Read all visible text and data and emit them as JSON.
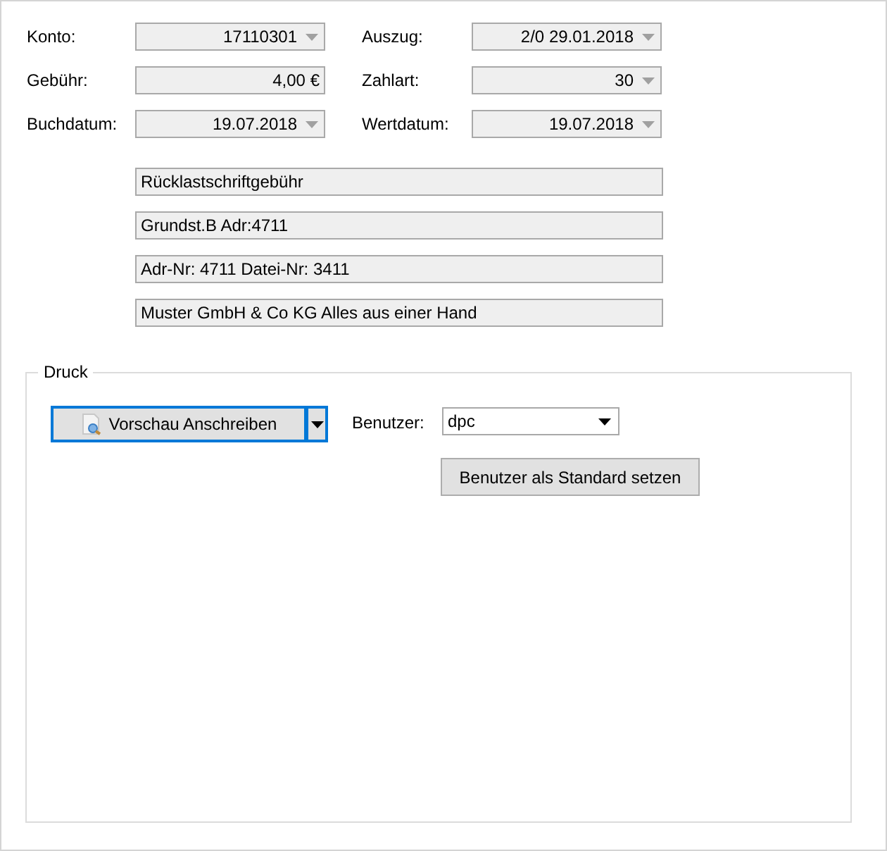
{
  "fields": [
    {
      "label": "Konto:",
      "value": "17110301",
      "kind": "combo"
    },
    {
      "label": "Auszug:",
      "value": "2/0 29.01.2018",
      "kind": "combo"
    },
    {
      "label": "Gebühr:",
      "value": "4,00 €",
      "kind": "text"
    },
    {
      "label": "Zahlart:",
      "value": "30",
      "kind": "combo"
    },
    {
      "label": "Buchdatum:",
      "value": "19.07.2018",
      "kind": "combo"
    },
    {
      "label": "Wertdatum:",
      "value": "19.07.2018",
      "kind": "combo"
    }
  ],
  "memo_lines": [
    "Rücklastschriftgebühr",
    "Grundst.B Adr:4711",
    "Adr-Nr: 4711 Datei-Nr: 3411",
    "Muster GmbH & Co KG Alles aus einer Hand"
  ],
  "print_group": {
    "title": "Druck",
    "split_button": {
      "label": "Vorschau Anschreiben",
      "focused": true
    },
    "user_label": "Benutzer:",
    "user_value": "dpc",
    "default_button": "Benutzer als Standard setzen"
  }
}
